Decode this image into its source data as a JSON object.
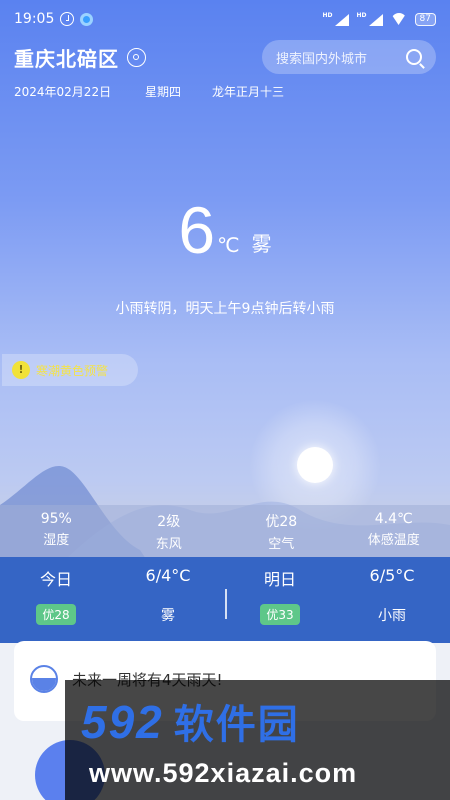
{
  "status_bar": {
    "time": "19:05",
    "signal1_label": "HD",
    "signal2_label": "HD",
    "battery": "87"
  },
  "header": {
    "city": "重庆北碚区",
    "search_placeholder": "搜索国内外城市"
  },
  "date": {
    "gregorian": "2024年02月22日",
    "weekday": "星期四",
    "lunar": "龙年正月十三"
  },
  "current": {
    "temperature": "6",
    "unit": "℃",
    "condition": "雾",
    "forecast_text": "小雨转阴，明天上午9点钟后转小雨"
  },
  "alert": {
    "icon_glyph": "!",
    "text": "寒潮黄色预警"
  },
  "metrics": [
    {
      "value": "95%",
      "label": "湿度"
    },
    {
      "value": "2级",
      "label": "东风"
    },
    {
      "value": "优28",
      "label": "空气"
    },
    {
      "value": "4.4℃",
      "label": "体感温度"
    }
  ],
  "daily": {
    "today": {
      "label": "今日",
      "temp": "6/4°C",
      "aqi": "优28",
      "condition": "雾"
    },
    "tomorrow": {
      "label": "明日",
      "temp": "6/5°C",
      "aqi": "优33",
      "condition": "小雨"
    }
  },
  "week_card": {
    "text": "未来一周将有4天雨天!"
  },
  "watermark": {
    "logo_number": "592",
    "logo_text": "软件园",
    "url": "www.592xiazai.com"
  },
  "colors": {
    "accent": "#3565c5",
    "aqi_good": "#5ec789",
    "alert_yellow": "#f1e239"
  }
}
